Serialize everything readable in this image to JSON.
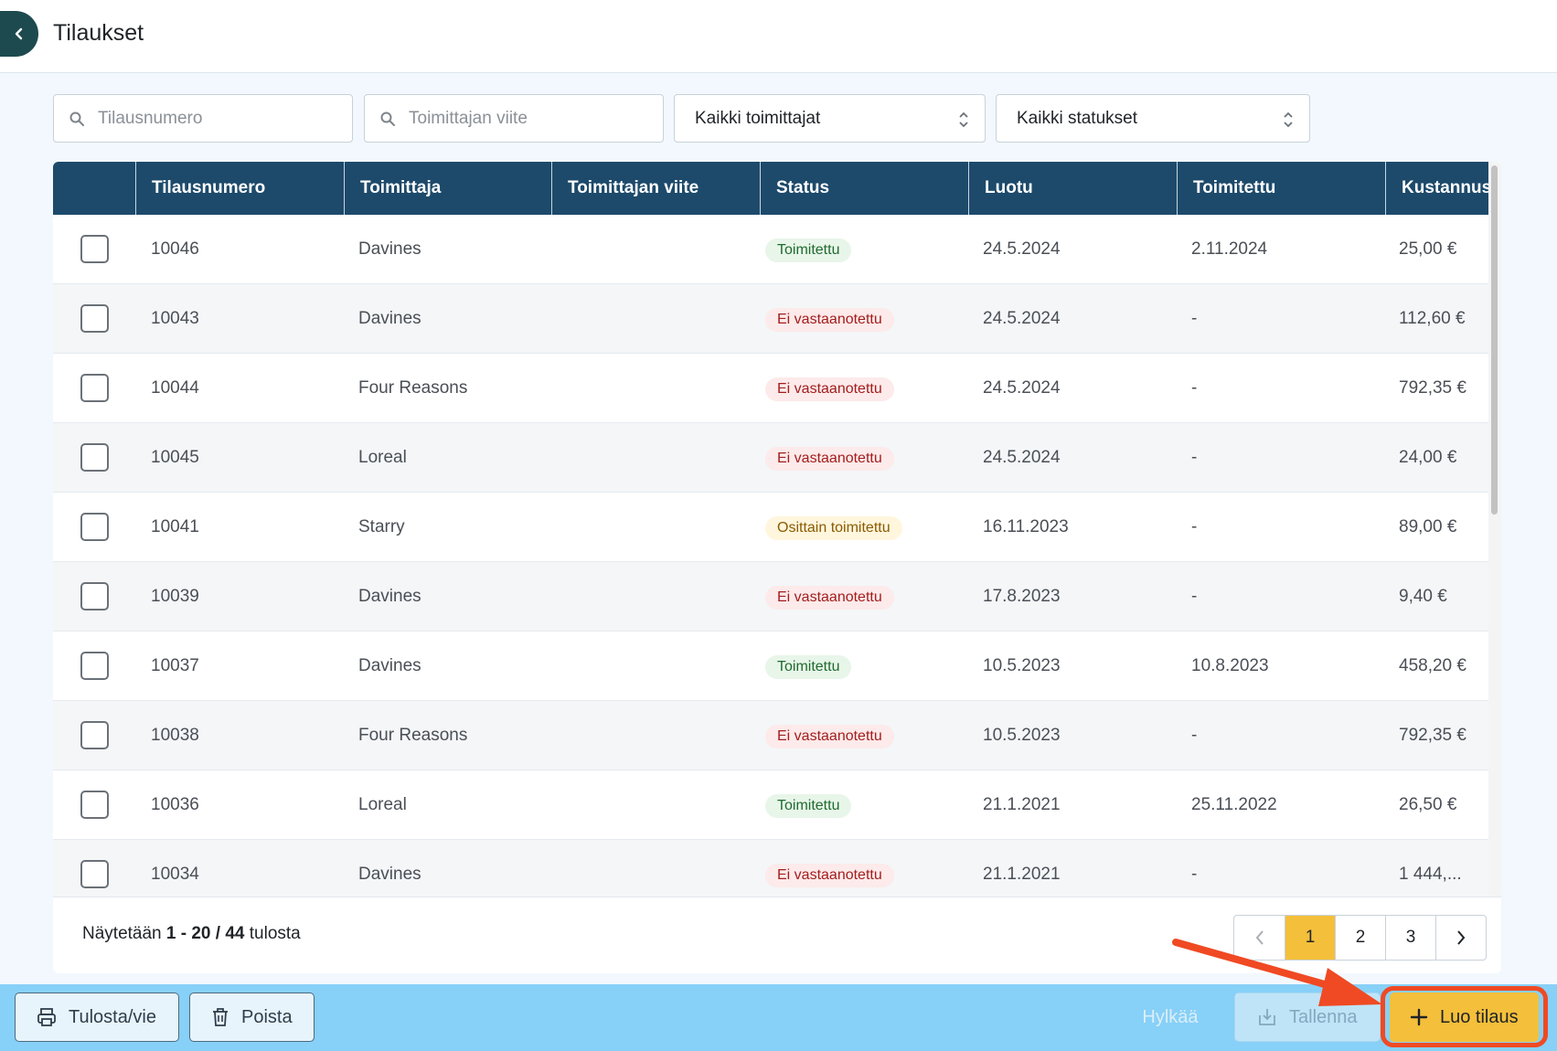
{
  "header": {
    "title": "Tilaukset"
  },
  "filters": {
    "order_number_placeholder": "Tilausnumero",
    "supplier_ref_placeholder": "Toimittajan viite",
    "supplier_select": "Kaikki toimittajat",
    "status_select": "Kaikki statukset"
  },
  "table": {
    "columns": [
      "Tilausnumero",
      "Toimittaja",
      "Toimittajan viite",
      "Status",
      "Luotu",
      "Toimitettu",
      "Kustannus"
    ],
    "rows": [
      {
        "number": "10046",
        "supplier": "Davines",
        "ref": "",
        "status": "Toimitettu",
        "status_type": "green",
        "created": "24.5.2024",
        "delivered": "2.11.2024",
        "cost": "25,00 €"
      },
      {
        "number": "10043",
        "supplier": "Davines",
        "ref": "",
        "status": "Ei vastaanotettu",
        "status_type": "red",
        "created": "24.5.2024",
        "delivered": "-",
        "cost": "112,60 €"
      },
      {
        "number": "10044",
        "supplier": "Four Reasons",
        "ref": "",
        "status": "Ei vastaanotettu",
        "status_type": "red",
        "created": "24.5.2024",
        "delivered": "-",
        "cost": "792,35 €"
      },
      {
        "number": "10045",
        "supplier": "Loreal",
        "ref": "",
        "status": "Ei vastaanotettu",
        "status_type": "red",
        "created": "24.5.2024",
        "delivered": "-",
        "cost": "24,00 €"
      },
      {
        "number": "10041",
        "supplier": "Starry",
        "ref": "",
        "status": "Osittain toimitettu",
        "status_type": "yellow",
        "created": "16.11.2023",
        "delivered": "-",
        "cost": "89,00 €"
      },
      {
        "number": "10039",
        "supplier": "Davines",
        "ref": "",
        "status": "Ei vastaanotettu",
        "status_type": "red",
        "created": "17.8.2023",
        "delivered": "-",
        "cost": "9,40 €"
      },
      {
        "number": "10037",
        "supplier": "Davines",
        "ref": "",
        "status": "Toimitettu",
        "status_type": "green",
        "created": "10.5.2023",
        "delivered": "10.8.2023",
        "cost": "458,20 €"
      },
      {
        "number": "10038",
        "supplier": "Four Reasons",
        "ref": "",
        "status": "Ei vastaanotettu",
        "status_type": "red",
        "created": "10.5.2023",
        "delivered": "-",
        "cost": "792,35 €"
      },
      {
        "number": "10036",
        "supplier": "Loreal",
        "ref": "",
        "status": "Toimitettu",
        "status_type": "green",
        "created": "21.1.2021",
        "delivered": "25.11.2022",
        "cost": "26,50 €"
      },
      {
        "number": "10034",
        "supplier": "Davines",
        "ref": "",
        "status": "Ei vastaanotettu",
        "status_type": "red",
        "created": "21.1.2021",
        "delivered": "-",
        "cost": "1 444,..."
      }
    ]
  },
  "footer": {
    "results_prefix": "Näytetään",
    "range": "1 - 20",
    "separator": "/",
    "total": "44",
    "results_suffix": "tulosta"
  },
  "pagination": {
    "pages": [
      "1",
      "2",
      "3"
    ],
    "active": "1"
  },
  "actions": {
    "print_label": "Tulosta/vie",
    "delete_label": "Poista",
    "reject_label": "Hylkää",
    "save_label": "Tallenna",
    "create_label": "Luo tilaus"
  },
  "colors": {
    "header_bg": "#1d4a6b",
    "accent": "#f4bf3a",
    "bottom_bar": "#87d0f7",
    "annotation": "#ef4a23"
  },
  "icons": [
    "chevron-left-icon",
    "search-icon",
    "sort-arrows-icon",
    "printer-icon",
    "trash-icon",
    "download-icon",
    "plus-icon",
    "chevron-right-icon"
  ]
}
